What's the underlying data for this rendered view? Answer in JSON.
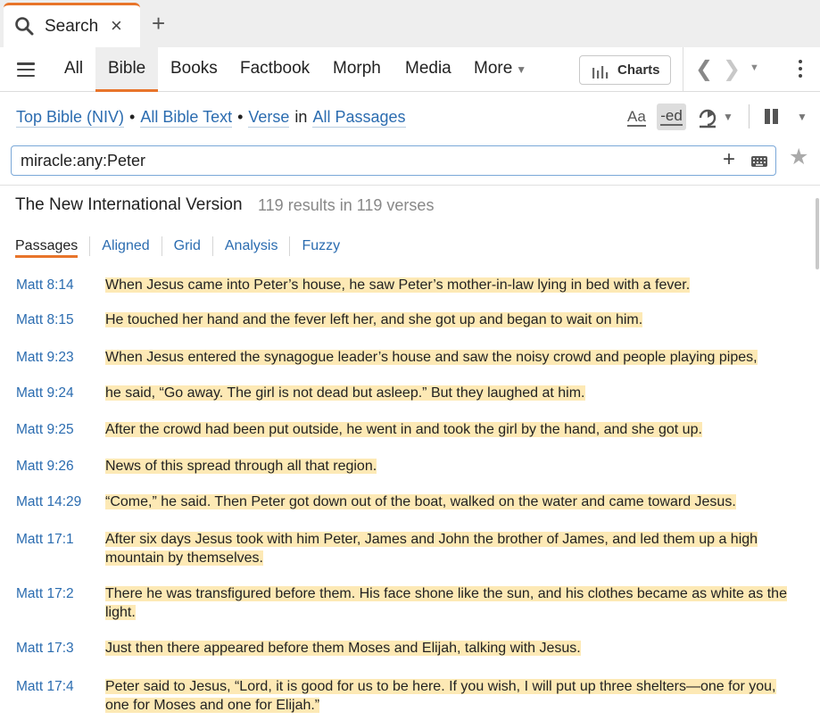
{
  "tab": {
    "label": "Search",
    "close": "×",
    "new_tab": "+"
  },
  "toolbar": {
    "tabs": [
      "All",
      "Bible",
      "Books",
      "Factbook",
      "Morph",
      "Media",
      "More"
    ],
    "active_tab": "Bible",
    "charts_label": "Charts"
  },
  "scope": {
    "bible": "Top Bible (NIV)",
    "text": "All Bible Text",
    "unit": "Verse",
    "in_word": "in",
    "range": "All Passages",
    "sep": "•"
  },
  "options": {
    "font_label": "Aa",
    "inflect_label": "-ed"
  },
  "search": {
    "query": "miracle:any:Peter"
  },
  "results": {
    "title": "The New International Version",
    "count": "119 results in 119 verses"
  },
  "subtabs": [
    "Passages",
    "Aligned",
    "Grid",
    "Analysis",
    "Fuzzy"
  ],
  "verses": [
    {
      "ref": "Matt 8:14",
      "text": "When Jesus came into Peter’s house, he saw Peter’s mother-in-law lying in bed with a fever."
    },
    {
      "ref": "Matt 8:15",
      "text": "He touched her hand and the fever left her, and she got up and began to wait on him."
    },
    {
      "ref": "Matt 9:23",
      "text": "When Jesus entered the synagogue leader’s house and saw the noisy crowd and people playing pipes,"
    },
    {
      "ref": "Matt 9:24",
      "text": "he said, “Go away. The girl is not dead but asleep.” But they laughed at him."
    },
    {
      "ref": "Matt 9:25",
      "text": "After the crowd had been put outside, he went in and took the girl by the hand, and she got up."
    },
    {
      "ref": "Matt 9:26",
      "text": "News of this spread through all that region."
    },
    {
      "ref": "Matt 14:29",
      "text": "“Come,” he said. Then Peter got down out of the boat, walked on the water and came toward Jesus."
    },
    {
      "ref": "Matt 17:1",
      "text": "After six days Jesus took with him Peter, James and John the brother of James, and led them up a high mountain by themselves."
    },
    {
      "ref": "Matt 17:2",
      "text": "There he was transfigured before them. His face shone like the sun, and his clothes became as white as the light."
    },
    {
      "ref": "Matt 17:3",
      "text": "Just then there appeared before them Moses and Elijah, talking with Jesus."
    },
    {
      "ref": "Matt 17:4",
      "text": "Peter said to Jesus, “Lord, it is good for us to be here. If you wish, I will put up three shelters—one for you, one for Moses and one for Elijah.”"
    }
  ]
}
